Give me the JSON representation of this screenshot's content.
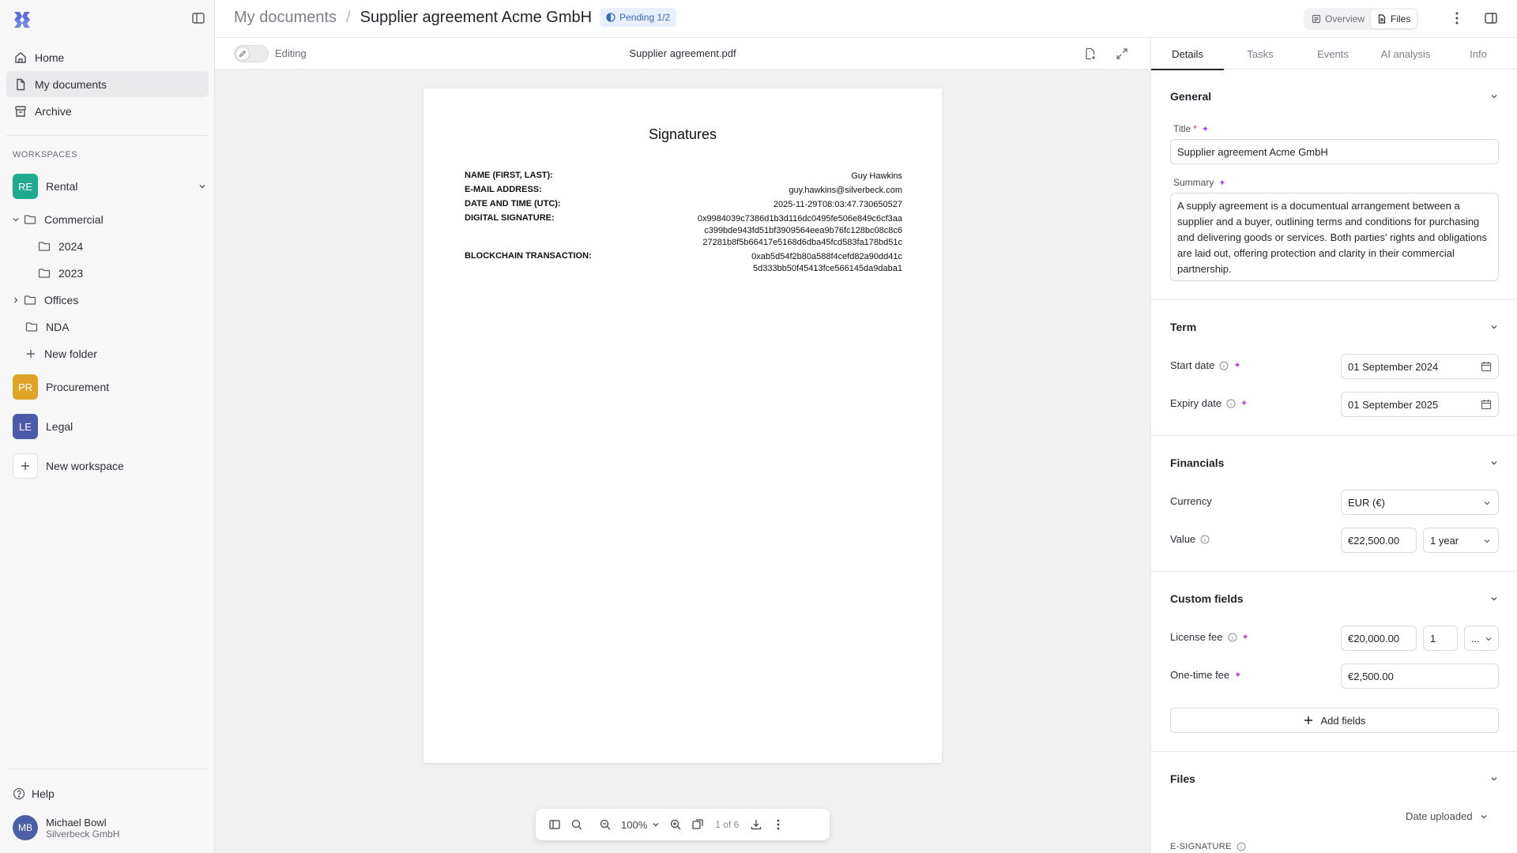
{
  "sidebar": {
    "nav": [
      {
        "label": "Home",
        "icon": "home-icon"
      },
      {
        "label": "My documents",
        "icon": "document-icon",
        "active": true
      },
      {
        "label": "Archive",
        "icon": "archive-icon"
      }
    ],
    "workspaces_title": "WORKSPACES",
    "workspaces": [
      {
        "initials": "RE",
        "label": "Rental",
        "color": "#1fa98f"
      },
      {
        "initials": "PR",
        "label": "Procurement",
        "color": "#e0a326"
      },
      {
        "initials": "LE",
        "label": "Legal",
        "color": "#4b5ba9"
      }
    ],
    "folders": {
      "commercial": "Commercial",
      "y2024": "2024",
      "y2023": "2023",
      "offices": "Offices",
      "nda": "NDA",
      "new_folder": "New folder"
    },
    "new_workspace": "New workspace",
    "help": "Help",
    "user": {
      "initials": "MB",
      "name": "Michael Bowl",
      "company": "Silverbeck GmbH"
    }
  },
  "header": {
    "breadcrumb_parent": "My documents",
    "breadcrumb_current": "Supplier agreement Acme GmbH",
    "status_badge": "Pending 1/2",
    "view_overview": "Overview",
    "view_files": "Files"
  },
  "viewer": {
    "editing_label": "Editing",
    "file_name": "Supplier agreement.pdf",
    "zoom": "100%",
    "page_indicator": "1 of 6"
  },
  "document": {
    "heading": "Signatures",
    "rows": [
      {
        "key": "NAME (FIRST, LAST):",
        "lines": [
          "Guy Hawkins"
        ]
      },
      {
        "key": "E-MAIL ADDRESS:",
        "lines": [
          "guy.hawkins@silverbeck.com"
        ]
      },
      {
        "key": "DATE AND TIME (UTC):",
        "lines": [
          "2025-11-29T08:03:47.730650527"
        ]
      },
      {
        "key": "DIGITAL SIGNATURE:",
        "lines": [
          "0x9984039c7386d1b3d116dc0495fe506e849c6cf3aa",
          "c399bde943fd51bf3909564eea9b76fc128bc08c8c6",
          "27281b8f5b66417e5168d6dba45fcd583fa178bd51c"
        ]
      },
      {
        "key": "BLOCKCHAIN TRANSACTION:",
        "lines": [
          "0xab5d54f2b80a588f4cefd82a90dd41c",
          "5d333bb50f45413fce566145da9daba1"
        ]
      }
    ]
  },
  "details": {
    "tabs": [
      "Details",
      "Tasks",
      "Events",
      "AI analysis",
      "Info"
    ],
    "general": {
      "heading": "General",
      "title_label": "Title",
      "title_value": "Supplier agreement Acme GmbH",
      "summary_label": "Summary",
      "summary_value": "A supply agreement is a documentual arrangement between a supplier and a buyer, outlining terms and conditions for purchasing and delivering goods or services. Both parties' rights and obligations are laid out, offering protection and clarity in their commercial partnership."
    },
    "term": {
      "heading": "Term",
      "start_label": "Start date",
      "start_value": "01 September 2024",
      "expiry_label": "Expiry date",
      "expiry_value": "01 September 2025"
    },
    "financials": {
      "heading": "Financials",
      "currency_label": "Currency",
      "currency_value": "EUR (€)",
      "value_label": "Value",
      "value_amount": "€22,500.00",
      "value_period": "1 year"
    },
    "custom": {
      "heading": "Custom fields",
      "license_label": "License fee",
      "license_amount": "€20,000.00",
      "license_qty": "1",
      "license_unit": "...",
      "onetime_label": "One-time fee",
      "onetime_amount": "€2,500.00",
      "add_fields": "Add fields"
    },
    "files": {
      "heading": "Files",
      "sort_label": "Date uploaded",
      "esignature_label": "E-SIGNATURE"
    }
  },
  "colors": {
    "accent": "#3566c9",
    "spark": "#b04ad6",
    "required": "#d1343b"
  }
}
